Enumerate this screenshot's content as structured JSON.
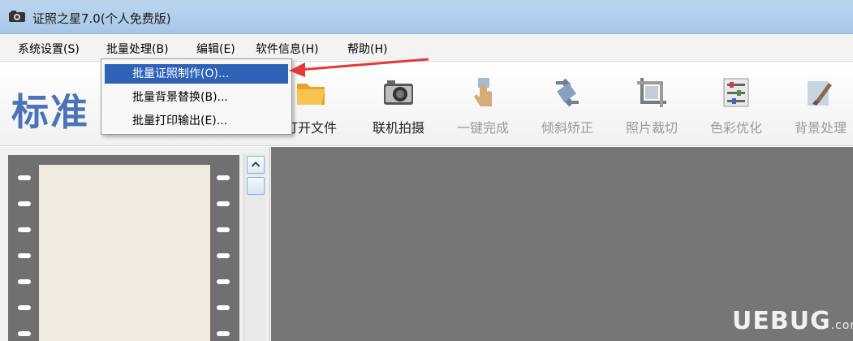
{
  "window": {
    "title": "证照之星7.0(个人免费版)"
  },
  "menubar": {
    "items": [
      {
        "label": "系统设置(S)"
      },
      {
        "label": "批量处理(B)"
      },
      {
        "label": "编辑(E)"
      },
      {
        "label": "软件信息(H)"
      },
      {
        "label": "帮助(H)"
      }
    ]
  },
  "dropdown": {
    "items": [
      {
        "label": "批量证照制作(O)...",
        "selected": true
      },
      {
        "label": "批量背景替换(B)..."
      },
      {
        "label": "批量打印输出(E)..."
      }
    ]
  },
  "toolbar": {
    "logo_text": "标准",
    "tools": [
      {
        "label": "打开文件",
        "icon": "folder-icon",
        "enabled": true
      },
      {
        "label": "联机拍摄",
        "icon": "camera-icon",
        "enabled": true
      },
      {
        "label": "一键完成",
        "icon": "hand-icon",
        "enabled": false
      },
      {
        "label": "倾斜矫正",
        "icon": "rotate-icon",
        "enabled": false
      },
      {
        "label": "照片裁切",
        "icon": "crop-icon",
        "enabled": false
      },
      {
        "label": "色彩优化",
        "icon": "sliders-icon",
        "enabled": false
      },
      {
        "label": "背景处理",
        "icon": "brush-icon",
        "enabled": false
      }
    ]
  },
  "watermark": {
    "text": "UEBUG",
    "sub": ".com"
  },
  "colors": {
    "accent": "#2f63b8",
    "annotation_arrow": "#e53935"
  }
}
